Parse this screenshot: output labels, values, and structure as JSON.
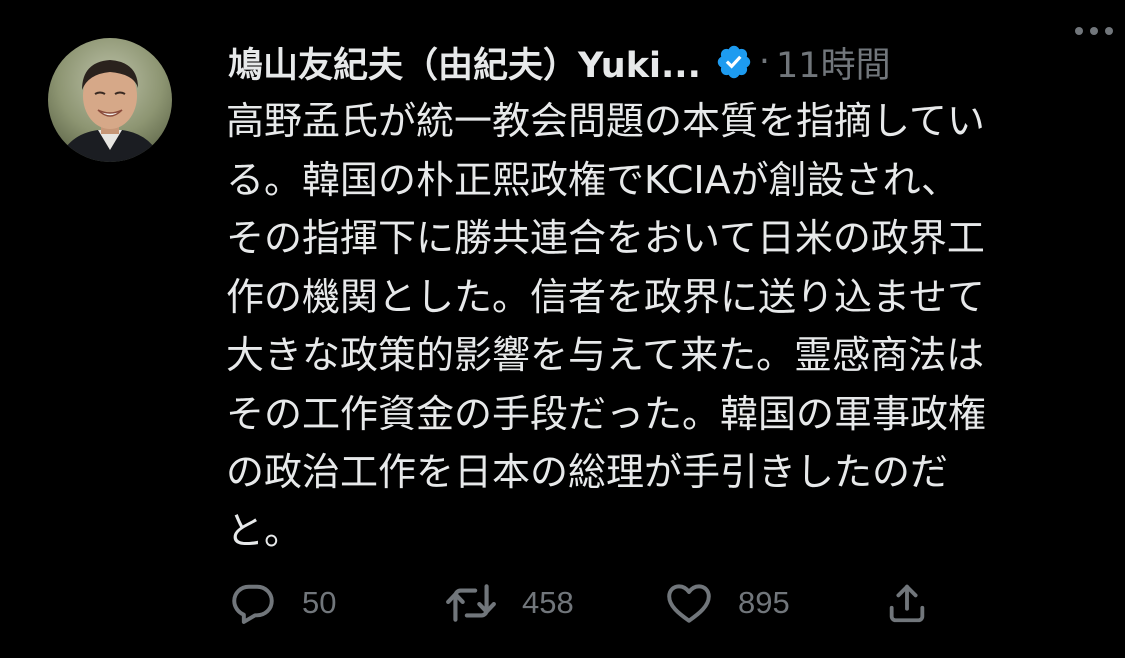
{
  "author": {
    "display_name": "鳩山友紀夫（由紀夫）Yuki...",
    "verified": true,
    "avatar_alt": "profile photo"
  },
  "meta": {
    "separator": "·",
    "timestamp": "11時間"
  },
  "tweet": {
    "lines": [
      "高野孟氏が統一教会問題の本質を指摘してい",
      "る。韓国の朴正熙政権でKCIAが創設され、",
      "その指揮下に勝共連合をおいて日米の政界工",
      "作の機関とした。信者を政界に送り込ませて",
      "大きな政策的影響を与えて来た。霊感商法は",
      "その工作資金の手段だった。韓国の軍事政権",
      "の政治工作を日本の総理が手引きしたのだ",
      "と。"
    ]
  },
  "actions": {
    "reply": {
      "icon": "reply-icon",
      "count": "50"
    },
    "retweet": {
      "icon": "retweet-icon",
      "count": "458"
    },
    "like": {
      "icon": "heart-icon",
      "count": "895"
    },
    "share": {
      "icon": "share-icon"
    }
  },
  "colors": {
    "background": "#000000",
    "text": "#e7e9ea",
    "secondary": "#71767b",
    "verified": "#1d9bf0"
  }
}
